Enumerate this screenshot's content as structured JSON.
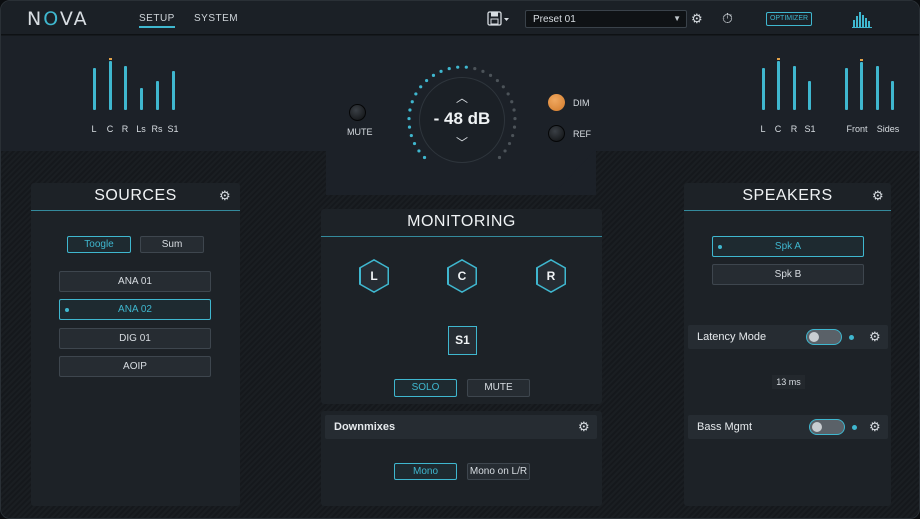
{
  "app": {
    "logo_pre": "N",
    "logo_o": "O",
    "logo_post": "VA"
  },
  "nav": {
    "setup": "SETUP",
    "system": "SYSTEM"
  },
  "toolbar": {
    "preset_value": "Preset 01",
    "optimizer_label": "OPTIMIZER"
  },
  "meters_left": {
    "labels": [
      "L",
      "C",
      "R",
      "Ls",
      "Rs",
      "S1"
    ],
    "levels": [
      0.78,
      0.9,
      0.82,
      0.4,
      0.54,
      0.72
    ]
  },
  "meters_right_a": {
    "labels": [
      "L",
      "C",
      "R",
      "S1"
    ],
    "levels": [
      0.78,
      0.9,
      0.82,
      0.54
    ]
  },
  "meters_right_b": {
    "levels": [
      0.78,
      0.88,
      0.82,
      0.54
    ],
    "labels": [
      "Front",
      "Sides"
    ]
  },
  "volume": {
    "value": "- 48 dB",
    "mute_label": "MUTE",
    "dim_label": "DIM",
    "ref_label": "REF",
    "dim_color": "#e8934a"
  },
  "sources": {
    "title": "SOURCES",
    "mode_buttons": [
      "Toogle",
      "Sum"
    ],
    "items": [
      "ANA 01",
      "ANA 02",
      "DIG 01",
      "AOIP"
    ],
    "selected_index": 1
  },
  "monitoring": {
    "title": "MONITORING",
    "channels": [
      "L",
      "C",
      "R"
    ],
    "sub_channel": "S1",
    "solo_label": "SOLO",
    "mute_label": "MUTE"
  },
  "downmixes": {
    "title": "Downmixes",
    "options": [
      "Mono",
      "Mono on L/R"
    ]
  },
  "speakers": {
    "title": "SPEAKERS",
    "items": [
      "Spk A",
      "Spk B"
    ],
    "latency_label": "Latency Mode",
    "latency_value": "13 ms",
    "bass_label": "Bass Mgmt"
  },
  "colors": {
    "accent": "#3fb7cf",
    "peak": "#e2a24a"
  }
}
